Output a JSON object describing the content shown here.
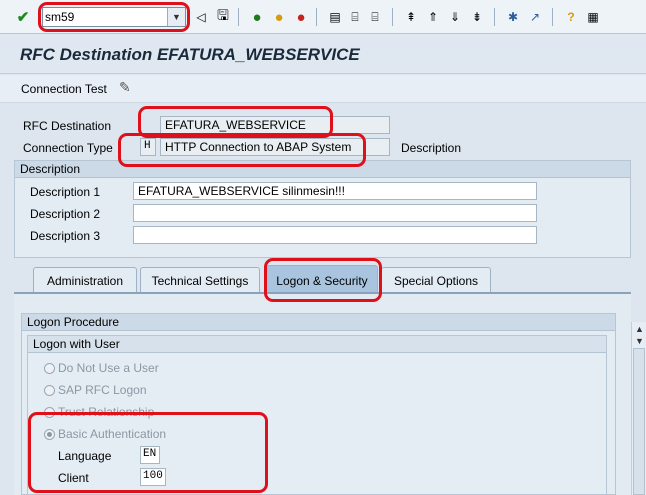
{
  "toolbar": {
    "command_value": "sm59"
  },
  "title": "RFC Destination EFATURA_WEBSERVICE",
  "app_toolbar": {
    "connection_test_label": "Connection Test"
  },
  "form": {
    "rfc_destination_label": "RFC Destination",
    "rfc_destination_value": "EFATURA_WEBSERVICE",
    "connection_type_label": "Connection Type",
    "connection_type_code": "H",
    "connection_type_text": "HTTP Connection to ABAP System",
    "description_side_label": "Description"
  },
  "description_group": {
    "title": "Description",
    "desc1_label": "Description 1",
    "desc1_value": "EFATURA_WEBSERVICE silinmesin!!!",
    "desc2_label": "Description 2",
    "desc2_value": "",
    "desc3_label": "Description 3",
    "desc3_value": ""
  },
  "tabs": [
    {
      "label": "Administration"
    },
    {
      "label": "Technical Settings"
    },
    {
      "label": "Logon & Security"
    },
    {
      "label": "Special Options"
    }
  ],
  "logon": {
    "procedure_title": "Logon Procedure",
    "with_user_title": "Logon with User",
    "options": [
      {
        "label": "Do Not Use a User",
        "selected": false
      },
      {
        "label": "SAP RFC Logon",
        "selected": false
      },
      {
        "label": "Trust Relationship",
        "selected": false
      },
      {
        "label": "Basic Authentication",
        "selected": true
      }
    ],
    "language_label": "Language",
    "language_value": "EN",
    "client_label": "Client",
    "client_value": "100"
  },
  "colors": {
    "annotation": "#e0101a",
    "active_tab": "#a9c4de"
  }
}
